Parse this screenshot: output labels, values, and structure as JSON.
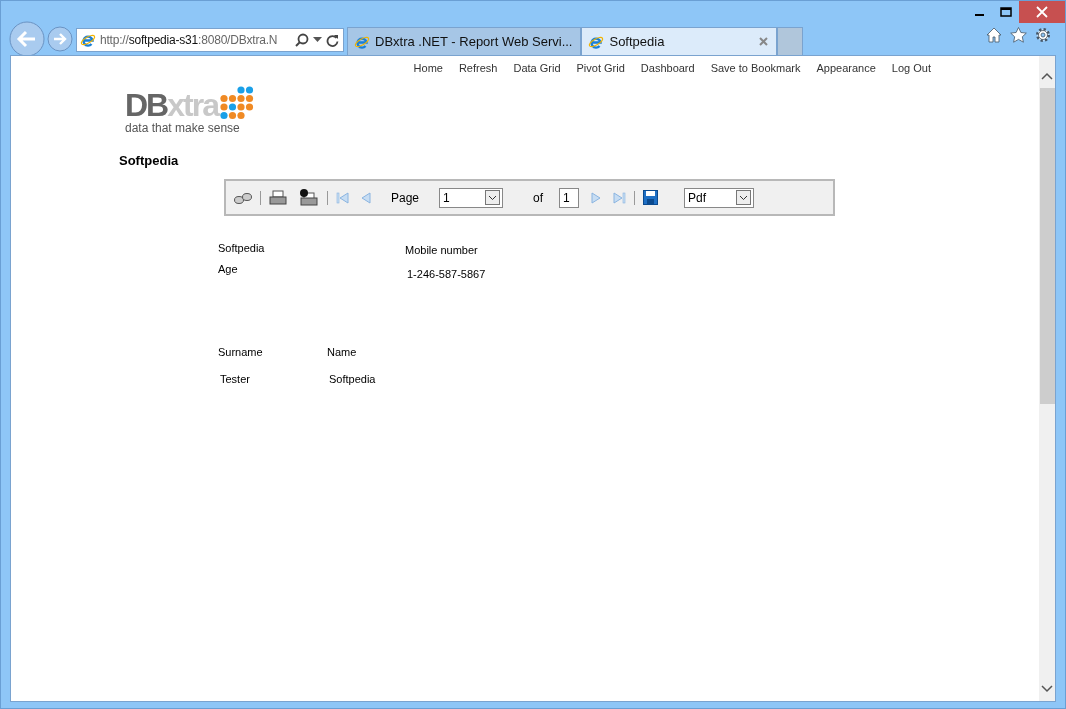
{
  "address_bar": {
    "url_parts": [
      {
        "text": "http://",
        "kind": "dim"
      },
      {
        "text": "softpedia-s31",
        "kind": "domain"
      },
      {
        "text": ":8080/DBxtra.N",
        "kind": "dim"
      }
    ]
  },
  "tabs": [
    {
      "label": "DBxtra .NET - Report Web Servi...",
      "selected": false
    },
    {
      "label": "Softpedia",
      "selected": true
    }
  ],
  "nav": [
    "Home",
    "Refresh",
    "Data Grid",
    "Pivot Grid",
    "Dashboard",
    "Save to Bookmark",
    "Appearance",
    "Log Out"
  ],
  "logo": {
    "brand_parts": [
      "DB",
      "xtra"
    ],
    "tagline": "data that make sense"
  },
  "page_title": "Softpedia",
  "report_toolbar": {
    "page_label": "Page",
    "page_value": "1",
    "of_label": "of",
    "page_total": "1",
    "format": "Pdf"
  },
  "report": {
    "header_left": [
      "Softpedia",
      "Age"
    ],
    "header_right_label": "Mobile number",
    "header_right_value": "1-246-587-5867",
    "columns": [
      "Surname",
      "Name"
    ],
    "row": [
      "Tester",
      "Softpedia"
    ]
  }
}
